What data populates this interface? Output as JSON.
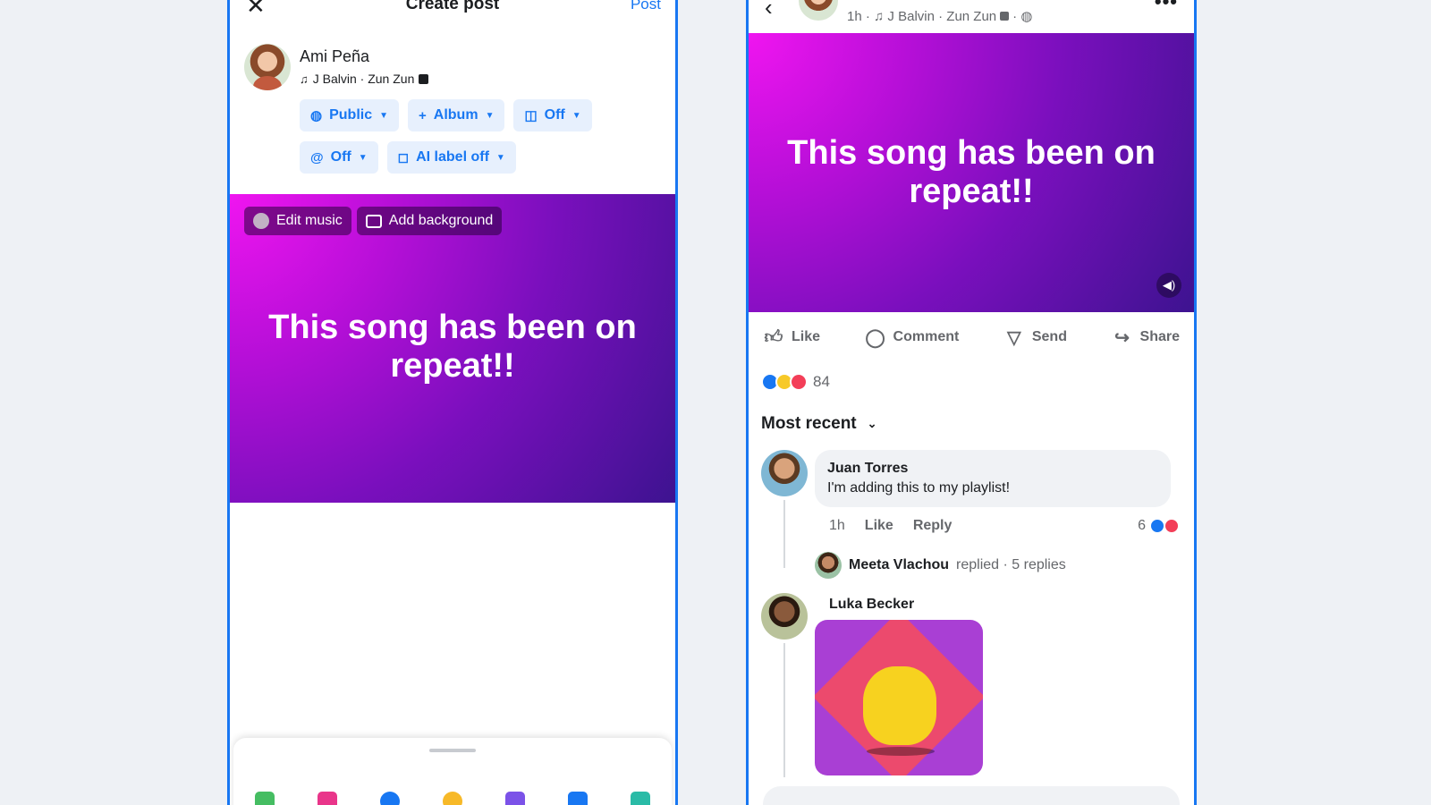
{
  "colors": {
    "accent": "#1877f2",
    "canvas_from": "#f015f0",
    "canvas_to": "#3d1390",
    "page_bg": "#eef1f5"
  },
  "create_post": {
    "close_icon": "close-icon",
    "title": "Create post",
    "post_label": "Post",
    "author_name": "Ami Peña",
    "song": "J Balvin · Zun Zun",
    "pills_row1": [
      {
        "label": "Public",
        "icon": "globe-icon"
      },
      {
        "label": "Album",
        "icon": "plus-icon"
      },
      {
        "label": "Off",
        "icon": "instagram-icon"
      }
    ],
    "pills_row2": [
      {
        "label": "Off",
        "icon": "threads-icon"
      },
      {
        "label": "AI label off",
        "icon": "ai-label-icon"
      }
    ],
    "edit_music_label": "Edit music",
    "add_background_label": "Add background",
    "post_text": "This song has been on repeat!!",
    "toolbar_icons": [
      "photo-icon",
      "music-icon",
      "tag-people-icon",
      "feeling-icon",
      "pen-icon",
      "camera-icon",
      "more-icon"
    ]
  },
  "post_view": {
    "meta": "1h · ♫ J Balvin · Zun Zun",
    "post_text": "This song has been on repeat!!",
    "actions": [
      {
        "label": "Like",
        "icon": "thumbs-up-icon"
      },
      {
        "label": "Comment",
        "icon": "comment-icon"
      },
      {
        "label": "Send",
        "icon": "send-icon"
      },
      {
        "label": "Share",
        "icon": "share-icon"
      }
    ],
    "reaction_count": "84",
    "sort_label": "Most recent",
    "comments": [
      {
        "name": "Juan Torres",
        "text": "I'm adding this to my playlist!",
        "time": "1h",
        "like": "Like",
        "reply": "Reply",
        "reactions": "6",
        "replies_name": "Meeta Vlachou",
        "replies_text": "replied · 5 replies"
      },
      {
        "name": "Luka Becker"
      }
    ]
  }
}
